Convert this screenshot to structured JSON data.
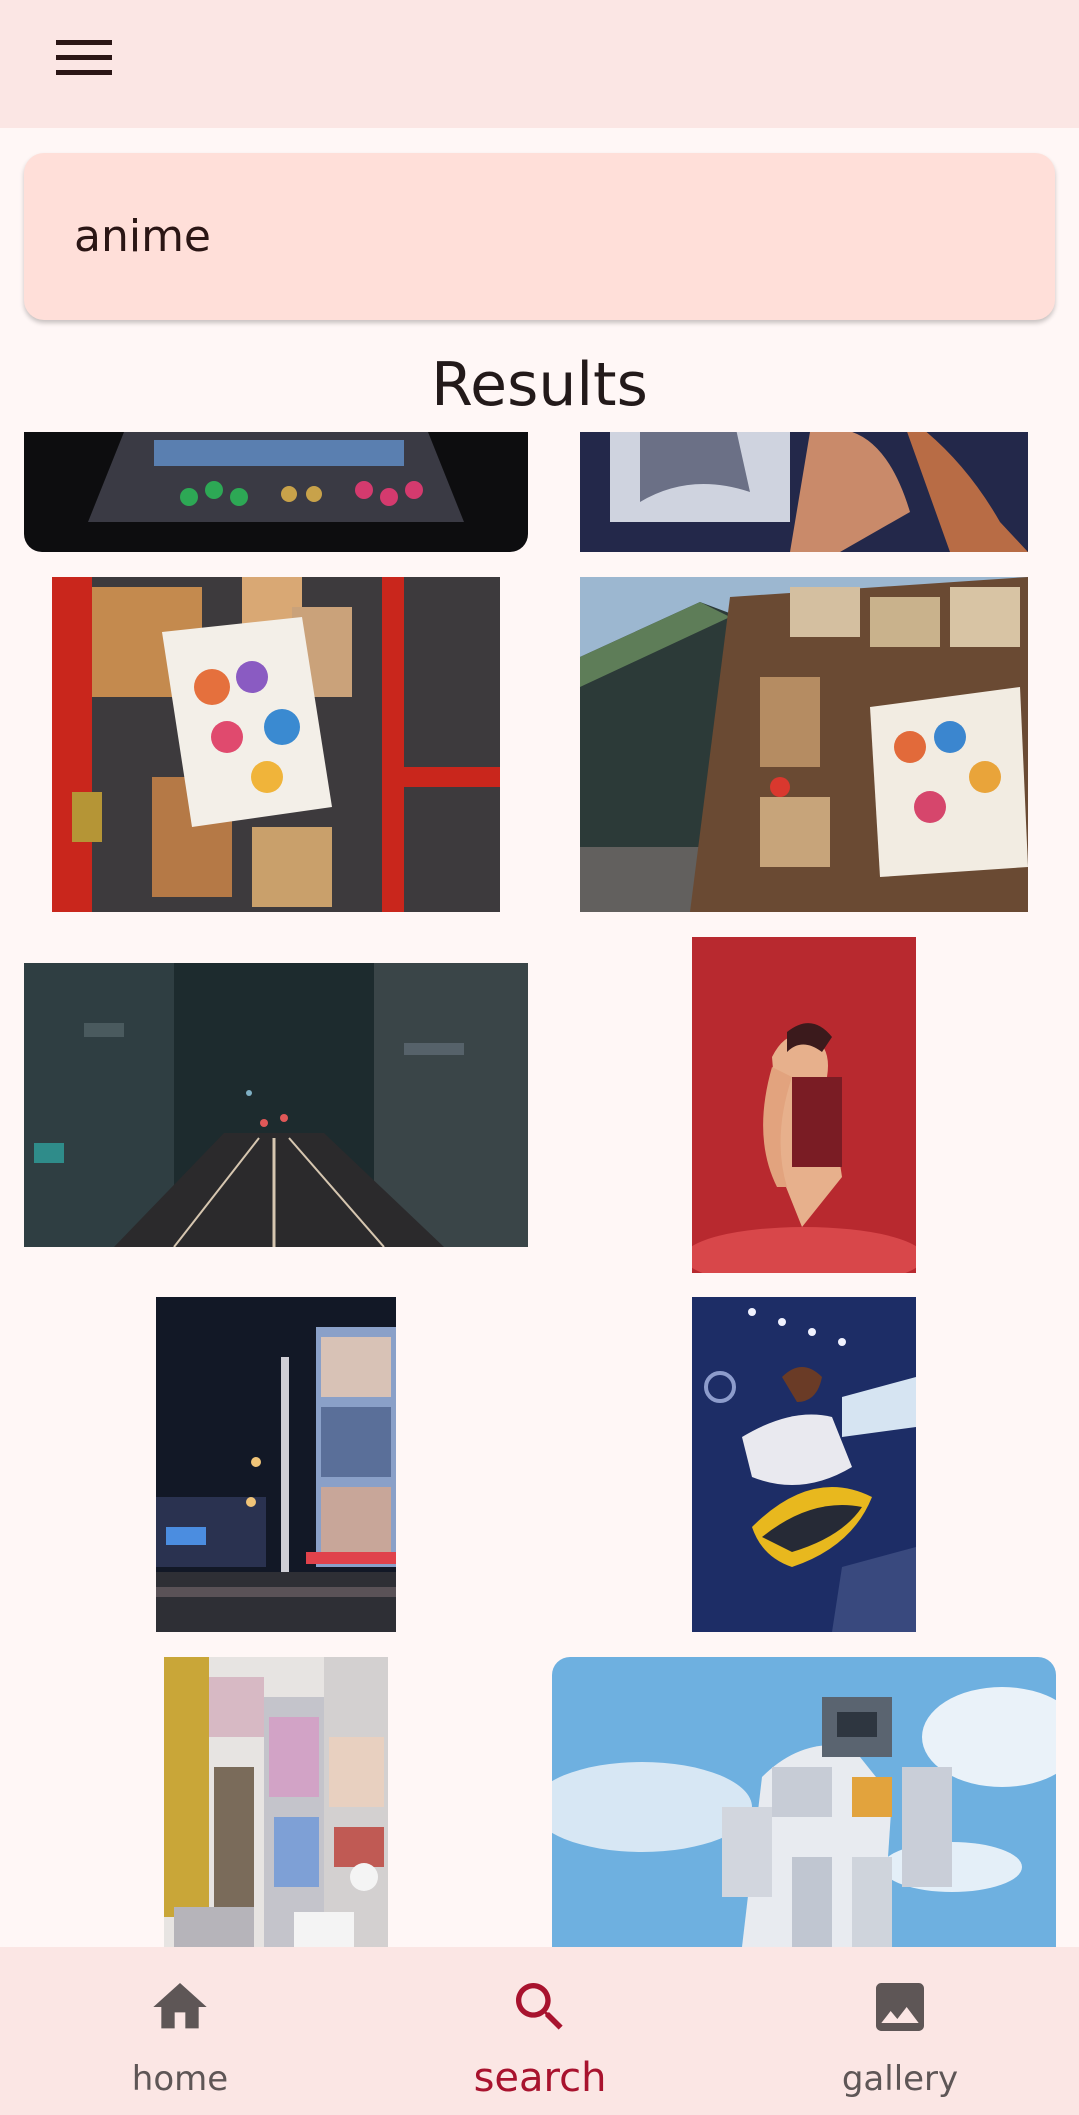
{
  "search": {
    "query": "anime"
  },
  "results": {
    "title": "Results"
  },
  "bottom_nav": {
    "items": [
      {
        "label": "home",
        "icon": "home-icon"
      },
      {
        "label": "search",
        "icon": "search-icon",
        "active": true
      },
      {
        "label": "gallery",
        "icon": "gallery-icon"
      }
    ]
  },
  "colors": {
    "app_bar": "#fbe6e4",
    "background": "#fff7f6",
    "search_field": "#ffdfd9",
    "active_nav": "#a8132e",
    "inactive_nav": "#5e5656"
  }
}
